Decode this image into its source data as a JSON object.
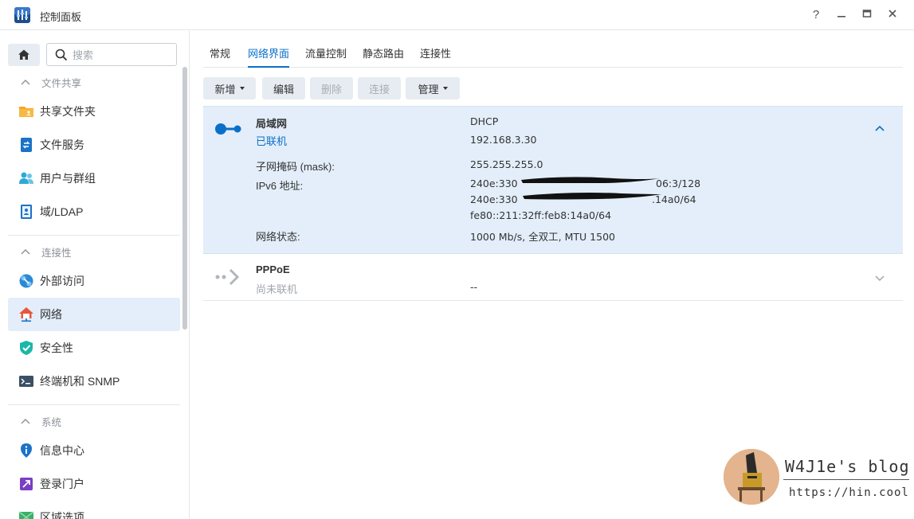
{
  "window": {
    "title": "控制面板",
    "help": "?",
    "minimize": "—",
    "maximize": "▭",
    "close": "✕"
  },
  "colors": {
    "accent": "#0a6fc8",
    "selected_bg": "#e3eefa",
    "button_bg": "#e6ecf2"
  },
  "sidebar": {
    "search_placeholder": "搜索",
    "groups": [
      {
        "label": "文件共享",
        "items": [
          {
            "label": "共享文件夹",
            "icon": "shared-folder-icon"
          },
          {
            "label": "文件服务",
            "icon": "file-services-icon"
          },
          {
            "label": "用户与群组",
            "icon": "users-group-icon"
          },
          {
            "label": "域/LDAP",
            "icon": "domain-ldap-icon"
          }
        ]
      },
      {
        "label": "连接性",
        "items": [
          {
            "label": "外部访问",
            "icon": "external-access-icon"
          },
          {
            "label": "网络",
            "icon": "network-house-icon",
            "active": true
          },
          {
            "label": "安全性",
            "icon": "security-shield-icon"
          },
          {
            "label": "终端机和 SNMP",
            "icon": "terminal-icon"
          }
        ]
      },
      {
        "label": "系统",
        "items": [
          {
            "label": "信息中心",
            "icon": "info-icon"
          },
          {
            "label": "登录门户",
            "icon": "login-portal-icon"
          },
          {
            "label": "区域选项",
            "icon": "regional-options-icon"
          }
        ]
      }
    ]
  },
  "tabs": [
    "常规",
    "网络界面",
    "流量控制",
    "静态路由",
    "连接性"
  ],
  "active_tab": 1,
  "toolbar": {
    "create": "新增",
    "edit": "编辑",
    "delete": "删除",
    "connect": "连接",
    "manage": "管理"
  },
  "interfaces": {
    "lan": {
      "name": "局域网",
      "status": "已联机",
      "mode": "DHCP",
      "ip": "192.168.3.30",
      "mask_label": "子网掩码 (mask):",
      "mask": "255.255.255.0",
      "ipv6_label": "IPv6 地址:",
      "ipv6_1": "240e:330",
      "ipv6_1_tail": "06:3/128",
      "ipv6_2": "240e:330",
      "ipv6_2_tail": ".14a0/64",
      "ipv6_3": "fe80::211:32ff:feb8:14a0/64",
      "net_status_label": "网络状态:",
      "net_status": "1000 Mb/s, 全双工, MTU 1500"
    },
    "pppoe": {
      "name": "PPPoE",
      "status": "尚未联机",
      "value": "--"
    }
  },
  "watermark": {
    "title": "W4J1e's blog",
    "url": "https://hin.cool"
  }
}
